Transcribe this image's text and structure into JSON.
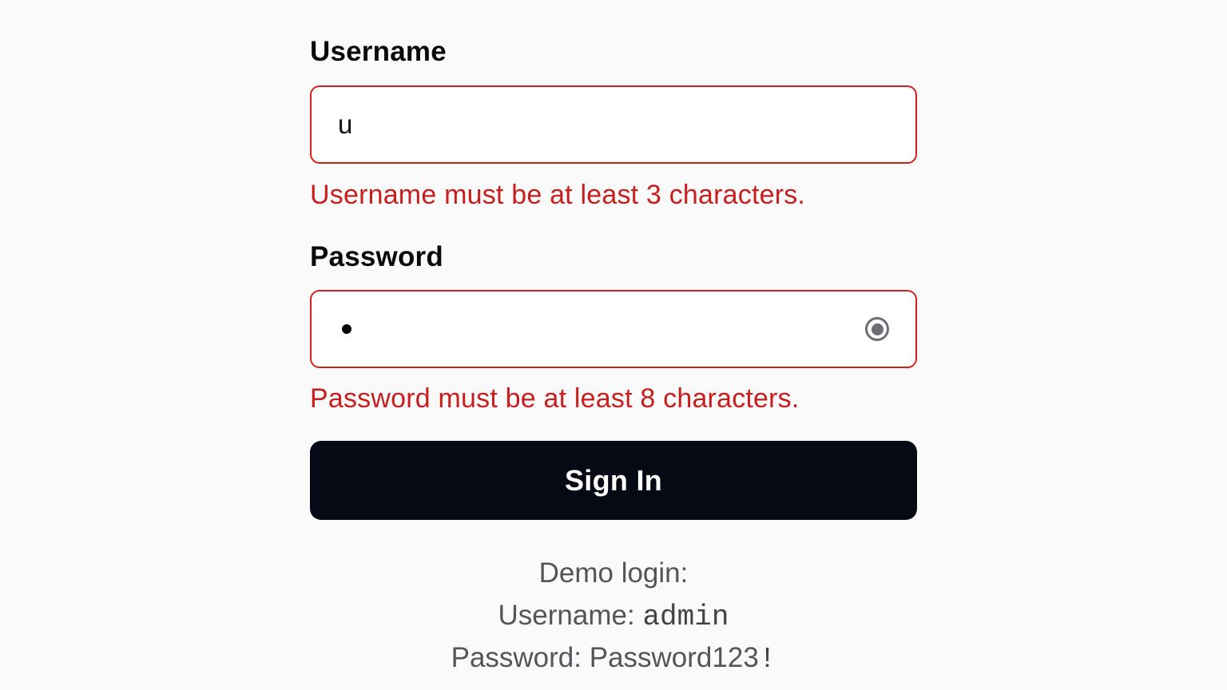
{
  "form": {
    "username": {
      "label": "Username",
      "value": "u",
      "error": "Username must be at least 3 characters."
    },
    "password": {
      "label": "Password",
      "value": "•",
      "error": "Password must be at least 8 characters.",
      "toggle_icon": "eye-icon"
    },
    "submit_label": "Sign In"
  },
  "demo": {
    "heading": "Demo login:",
    "username_prefix": "Username: ",
    "username_value": "admin",
    "password_prefix": "Password: ",
    "password_value": "Password123",
    "password_suffix": "!"
  },
  "colors": {
    "error": "#c81e1e",
    "button_bg": "#050a14",
    "page_bg": "#fafafa"
  }
}
